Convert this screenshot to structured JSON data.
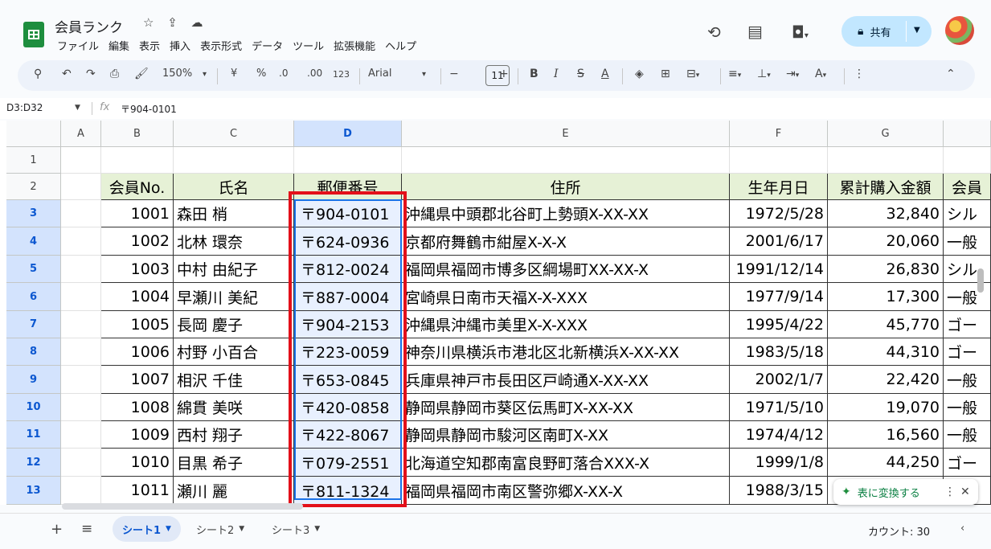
{
  "app": {
    "doc_title": "会員ランク",
    "title_icons": "☆ ⇪ ☁",
    "menu": [
      "ファイル",
      "編集",
      "表示",
      "挿入",
      "表示形式",
      "データ",
      "ツール",
      "拡張機能",
      "ヘルプ"
    ],
    "share_label": "共有"
  },
  "toolbar": {
    "zoom": "150%",
    "currency": "¥",
    "percent": "%",
    "dec_less": ".0",
    "dec_more": ".00",
    "format_123": "123",
    "font": "Arial",
    "font_size": "11",
    "bold": "B",
    "italic": "I",
    "strike": "S",
    "text_color": "A"
  },
  "formula_bar": {
    "name_box": "D3:D32",
    "fx": "fx",
    "value": "〒904-0101"
  },
  "columns": [
    "A",
    "B",
    "C",
    "D",
    "E",
    "F",
    "G"
  ],
  "rows": [
    "1",
    "2",
    "3",
    "4",
    "5",
    "6",
    "7",
    "8",
    "9",
    "10",
    "11",
    "12",
    "13"
  ],
  "table": {
    "headers": [
      "会員No.",
      "氏名",
      "郵便番号",
      "住所",
      "生年月日",
      "累計購入金額",
      "会員"
    ],
    "rows": [
      [
        "1001",
        "森田 梢",
        "〒904-0101",
        "沖縄県中頭郡北谷町上勢頭X-XX-XX",
        "1972/5/28",
        "32,840",
        "シル"
      ],
      [
        "1002",
        "北林 環奈",
        "〒624-0936",
        "京都府舞鶴市紺屋X-X-X",
        "2001/6/17",
        "20,060",
        "一般"
      ],
      [
        "1003",
        "中村 由紀子",
        "〒812-0024",
        "福岡県福岡市博多区綱場町XX-XX-X",
        "1991/12/14",
        "26,830",
        "シル"
      ],
      [
        "1004",
        "早瀬川 美紀",
        "〒887-0004",
        "宮崎県日南市天福X-X-XXX",
        "1977/9/14",
        "17,300",
        "一般"
      ],
      [
        "1005",
        "長岡 慶子",
        "〒904-2153",
        "沖縄県沖縄市美里X-X-XXX",
        "1995/4/22",
        "45,770",
        "ゴー"
      ],
      [
        "1006",
        "村野 小百合",
        "〒223-0059",
        "神奈川県横浜市港北区北新横浜X-XX-XX",
        "1983/5/18",
        "44,310",
        "ゴー"
      ],
      [
        "1007",
        "相沢 千佳",
        "〒653-0845",
        "兵庫県神戸市長田区戸崎通X-XX-XX",
        "2002/1/7",
        "22,420",
        "一般"
      ],
      [
        "1008",
        "綿貫 美咲",
        "〒420-0858",
        "静岡県静岡市葵区伝馬町X-XX-XX",
        "1971/5/10",
        "19,070",
        "一般"
      ],
      [
        "1009",
        "西村 翔子",
        "〒422-8067",
        "静岡県静岡市駿河区南町X-XX",
        "1974/4/12",
        "16,560",
        "一般"
      ],
      [
        "1010",
        "目黒 希子",
        "〒079-2551",
        "北海道空知郡南富良野町落合XXX-X",
        "1999/1/8",
        "44,250",
        "ゴー"
      ],
      [
        "1011",
        "瀬川 麗",
        "〒811-1324",
        "福岡県福岡市南区警弥郷X-XX-X",
        "1988/3/15",
        "",
        ""
      ]
    ]
  },
  "convert_chip": {
    "label": "表に変換する",
    "more": "⋮",
    "close": "✕"
  },
  "sheets": [
    "シート1",
    "シート2",
    "シート3"
  ],
  "status": {
    "count": "カウント: 30"
  }
}
